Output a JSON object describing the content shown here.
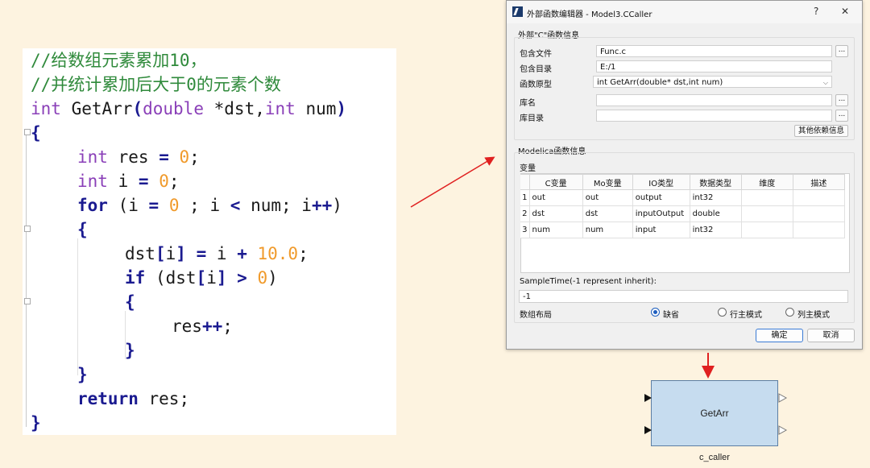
{
  "code": {
    "lines": [
      {
        "segs": [
          [
            "cm",
            "//给数组元素累加10，"
          ]
        ]
      },
      {
        "segs": [
          [
            "cm",
            "//并统计累加后大于0的元素个数"
          ]
        ]
      },
      {
        "segs": [
          [
            "kw",
            "int"
          ],
          [
            "",
            "GetArr"
          ],
          [
            "op",
            "("
          ],
          [
            "kw",
            "double"
          ],
          [
            "",
            "*"
          ],
          [
            "",
            "dst,"
          ],
          [
            "kw",
            "int"
          ],
          [
            "",
            "num"
          ],
          [
            "op",
            ")"
          ]
        ]
      },
      {
        "segs": [
          [
            "kb",
            "{"
          ]
        ]
      },
      {
        "segs": [
          [
            "kw",
            "int"
          ],
          [
            "",
            "res"
          ],
          [
            "op",
            "="
          ],
          [
            "num",
            "0"
          ],
          [
            "",
            ";"
          ]
        ]
      },
      {
        "segs": [
          [
            "kw",
            "int"
          ],
          [
            "",
            "i"
          ],
          [
            "op",
            "="
          ],
          [
            "num",
            "0"
          ],
          [
            "",
            ";"
          ]
        ]
      },
      {
        "segs": [
          [
            "kb",
            "for"
          ],
          [
            "",
            "(i"
          ],
          [
            "op",
            "="
          ],
          [
            "num",
            "0"
          ],
          [
            "",
            "; i"
          ],
          [
            "op",
            "<"
          ],
          [
            "",
            "num; i"
          ],
          [
            "op",
            "++"
          ],
          [
            "",
            ")"
          ]
        ]
      },
      {
        "segs": [
          [
            "kb",
            "{"
          ]
        ]
      },
      {
        "segs": [
          [
            "",
            "dst"
          ],
          [
            "op",
            "["
          ],
          [
            "",
            "i"
          ],
          [
            "op",
            "]"
          ],
          [
            "op",
            "="
          ],
          [
            "",
            "i"
          ],
          [
            "op",
            "+"
          ],
          [
            "num",
            "10.0"
          ],
          [
            "",
            ";"
          ]
        ]
      },
      {
        "segs": [
          [
            "kb",
            "if"
          ],
          [
            "",
            "(dst"
          ],
          [
            "op",
            "["
          ],
          [
            "",
            "i"
          ],
          [
            "op",
            "]"
          ],
          [
            "op",
            ">"
          ],
          [
            "num",
            "0"
          ],
          [
            "",
            ")"
          ]
        ]
      },
      {
        "segs": [
          [
            "kb",
            "{"
          ]
        ]
      },
      {
        "segs": [
          [
            "",
            "res"
          ],
          [
            "op",
            "++"
          ],
          [
            "",
            ";"
          ]
        ]
      },
      {
        "segs": [
          [
            "kb",
            "}"
          ]
        ]
      },
      {
        "segs": [
          [
            "kb",
            "}"
          ]
        ]
      },
      {
        "segs": [
          [
            "kb",
            "return"
          ],
          [
            "",
            "res;"
          ]
        ]
      },
      {
        "segs": [
          [
            "kb",
            "}"
          ]
        ]
      }
    ],
    "colors": {
      "comment": "#2f8a3b",
      "type": "#8a3fb8",
      "keyword": "#1a1a90",
      "number": "#f09a2b"
    }
  },
  "dialog": {
    "title": "外部函数编辑器 - Model3.CCaller",
    "help": "?",
    "close": "✕",
    "c_group": "外部\"C\"函数信息",
    "include_file_label": "包含文件",
    "include_file_value": "Func.c",
    "include_dir_label": "包含目录",
    "include_dir_value": "E:/1",
    "prototype_label": "函数原型",
    "prototype_value": "int GetArr(double* dst,int num)",
    "lib_name_label": "库名",
    "lib_name_value": "",
    "lib_dir_label": "库目录",
    "lib_dir_value": "",
    "browse": "...",
    "other_deps": "其他依赖信息",
    "modelica_group": "Modelica函数信息",
    "vars_label": "变量",
    "columns": [
      "C变量",
      "Mo变量",
      "IO类型",
      "数据类型",
      "维度",
      "描述"
    ],
    "rows": [
      {
        "n": "1",
        "c": "out",
        "mo": "out",
        "io": "output",
        "type": "int32",
        "dim": "",
        "desc": ""
      },
      {
        "n": "2",
        "c": "dst",
        "mo": "dst",
        "io": "inputOutput",
        "type": "double",
        "dim": "",
        "desc": ""
      },
      {
        "n": "3",
        "c": "num",
        "mo": "num",
        "io": "input",
        "type": "int32",
        "dim": "",
        "desc": ""
      }
    ],
    "sample_time_label": "SampleTime(-1 represent inherit):",
    "sample_time_value": "-1",
    "layout_label": "数组布局",
    "layout_options": [
      "缺省",
      "行主模式",
      "列主模式"
    ],
    "layout_selected": "缺省",
    "ok": "确定",
    "cancel": "取消"
  },
  "block": {
    "name": "GetArr",
    "label": "c_caller"
  },
  "colors": {
    "arrow": "#e02020",
    "block_fill": "#c6dcef",
    "block_border": "#5c7ea3",
    "accent": "#3a7bd5"
  }
}
